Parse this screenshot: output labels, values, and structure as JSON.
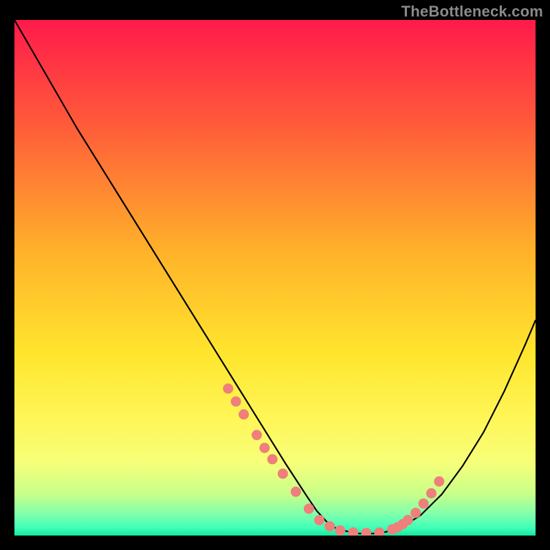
{
  "watermark": {
    "text": "TheBottleneck.com"
  },
  "chart_data": {
    "type": "line",
    "title": "",
    "xlabel": "",
    "ylabel": "",
    "xlim": [
      0,
      100
    ],
    "ylim": [
      0,
      100
    ],
    "grid": false,
    "legend": false,
    "background_gradient": {
      "stops": [
        {
          "pos": 0.0,
          "color": "#ff1a4b"
        },
        {
          "pos": 0.2,
          "color": "#ff5a3a"
        },
        {
          "pos": 0.45,
          "color": "#ffb22a"
        },
        {
          "pos": 0.65,
          "color": "#ffe62e"
        },
        {
          "pos": 0.78,
          "color": "#fff75a"
        },
        {
          "pos": 0.86,
          "color": "#f6ff7a"
        },
        {
          "pos": 0.92,
          "color": "#c7ff8a"
        },
        {
          "pos": 0.96,
          "color": "#7dffad"
        },
        {
          "pos": 0.985,
          "color": "#3fffb8"
        },
        {
          "pos": 1.0,
          "color": "#16e89e"
        }
      ]
    },
    "series": [
      {
        "name": "bottleneck-curve",
        "type": "line",
        "color": "#000000",
        "x": [
          0,
          4,
          8,
          12,
          16,
          20,
          24,
          28,
          32,
          36,
          40,
          44,
          48,
          52,
          56,
          58,
          60,
          62,
          66,
          70,
          74,
          78,
          82,
          86,
          90,
          94,
          98,
          100
        ],
        "y": [
          100,
          93,
          86,
          79,
          72.5,
          66,
          59.5,
          53,
          46.5,
          40,
          33.5,
          27,
          20.5,
          14,
          7.8,
          4.8,
          2.6,
          1.2,
          0.4,
          0.4,
          1.4,
          4.0,
          8.0,
          13.5,
          20.0,
          28.0,
          37.0,
          41.8
        ]
      },
      {
        "name": "highlight-dots",
        "type": "scatter",
        "color": "#ef7f7b",
        "x": [
          41.0,
          42.5,
          44.0,
          46.5,
          48.0,
          49.5,
          51.5,
          54.0,
          56.5,
          58.5,
          60.5,
          62.5,
          65.0,
          67.5,
          70.0,
          72.5,
          73.5,
          74.5,
          75.5,
          77.0,
          78.5,
          80.0,
          81.5
        ],
        "y": [
          28.5,
          26.0,
          23.5,
          19.5,
          17.0,
          14.8,
          12.0,
          8.5,
          5.2,
          3.0,
          1.8,
          1.0,
          0.6,
          0.5,
          0.6,
          1.2,
          1.6,
          2.2,
          3.0,
          4.4,
          6.2,
          8.2,
          10.5
        ]
      }
    ]
  }
}
